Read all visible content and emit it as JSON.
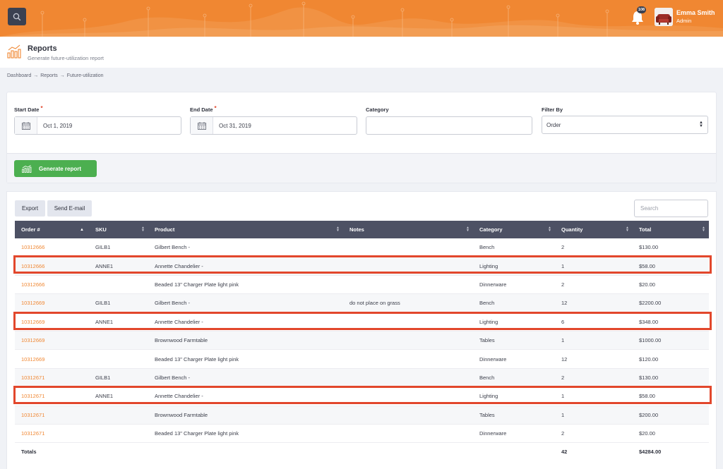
{
  "topbar": {
    "notification_count": "108",
    "user_name": "Emma Smith",
    "user_role": "Admin"
  },
  "page": {
    "title": "Reports",
    "subtitle": "Generate future-utilization report"
  },
  "breadcrumb": [
    "Dashboard",
    "Reports",
    "Future-utilization"
  ],
  "filters": {
    "start_date_label": "Start Date",
    "start_date_value": "Oct 1, 2019",
    "end_date_label": "End Date",
    "end_date_value": "Oct 31, 2019",
    "category_label": "Category",
    "category_value": "",
    "filter_by_label": "Filter By",
    "filter_by_value": "Order",
    "required_mark": "*",
    "generate_label": "Generate report"
  },
  "toolbar": {
    "export_label": "Export",
    "email_label": "Send E-mail",
    "search_placeholder": "Search"
  },
  "table": {
    "columns": [
      "Order #",
      "SKU",
      "Product",
      "Notes",
      "Category",
      "Quantity",
      "Total"
    ],
    "rows": [
      {
        "order": "10312666",
        "sku": "GILB1",
        "product": "Gilbert Bench -",
        "notes": "",
        "category": "Bench",
        "quantity": "2",
        "total": "$130.00"
      },
      {
        "order": "10312666",
        "sku": "ANNE1",
        "product": "Annette Chandelier -",
        "notes": "",
        "category": "Lighting",
        "quantity": "1",
        "total": "$58.00"
      },
      {
        "order": "10312666",
        "sku": "",
        "product": "Beaded 13\" Charger Plate light pink",
        "notes": "",
        "category": "Dinnerware",
        "quantity": "2",
        "total": "$20.00"
      },
      {
        "order": "10312669",
        "sku": "GILB1",
        "product": "Gilbert Bench -",
        "notes": "do not place on grass",
        "category": "Bench",
        "quantity": "12",
        "total": "$2200.00"
      },
      {
        "order": "10312669",
        "sku": "ANNE1",
        "product": "Annette Chandelier -",
        "notes": "",
        "category": "Lighting",
        "quantity": "6",
        "total": "$348.00"
      },
      {
        "order": "10312669",
        "sku": "",
        "product": "Brownwood Farmtable",
        "notes": "",
        "category": "Tables",
        "quantity": "1",
        "total": "$1000.00"
      },
      {
        "order": "10312669",
        "sku": "",
        "product": "Beaded 13\" Charger Plate light pink",
        "notes": "",
        "category": "Dinnerware",
        "quantity": "12",
        "total": "$120.00"
      },
      {
        "order": "10312671",
        "sku": "GILB1",
        "product": "Gilbert Bench -",
        "notes": "",
        "category": "Bench",
        "quantity": "2",
        "total": "$130.00"
      },
      {
        "order": "10312671",
        "sku": "ANNE1",
        "product": "Annette Chandelier -",
        "notes": "",
        "category": "Lighting",
        "quantity": "1",
        "total": "$58.00"
      },
      {
        "order": "10312671",
        "sku": "",
        "product": "Brownwood Farmtable",
        "notes": "",
        "category": "Tables",
        "quantity": "1",
        "total": "$200.00"
      },
      {
        "order": "10312671",
        "sku": "",
        "product": "Beaded 13\" Charger Plate light pink",
        "notes": "",
        "category": "Dinnerware",
        "quantity": "2",
        "total": "$20.00"
      }
    ],
    "totals": {
      "label": "Totals",
      "quantity": "42",
      "total": "$4284.00"
    },
    "highlighted_rows": [
      1,
      4,
      8
    ]
  },
  "colors": {
    "brand": "#f08732",
    "header_dark": "#4d5164",
    "success": "#4caf50",
    "highlight": "#e2472c"
  },
  "icons": [
    "search-icon",
    "bell-icon",
    "bar-chart-icon",
    "calendar-icon",
    "sort-icon"
  ]
}
